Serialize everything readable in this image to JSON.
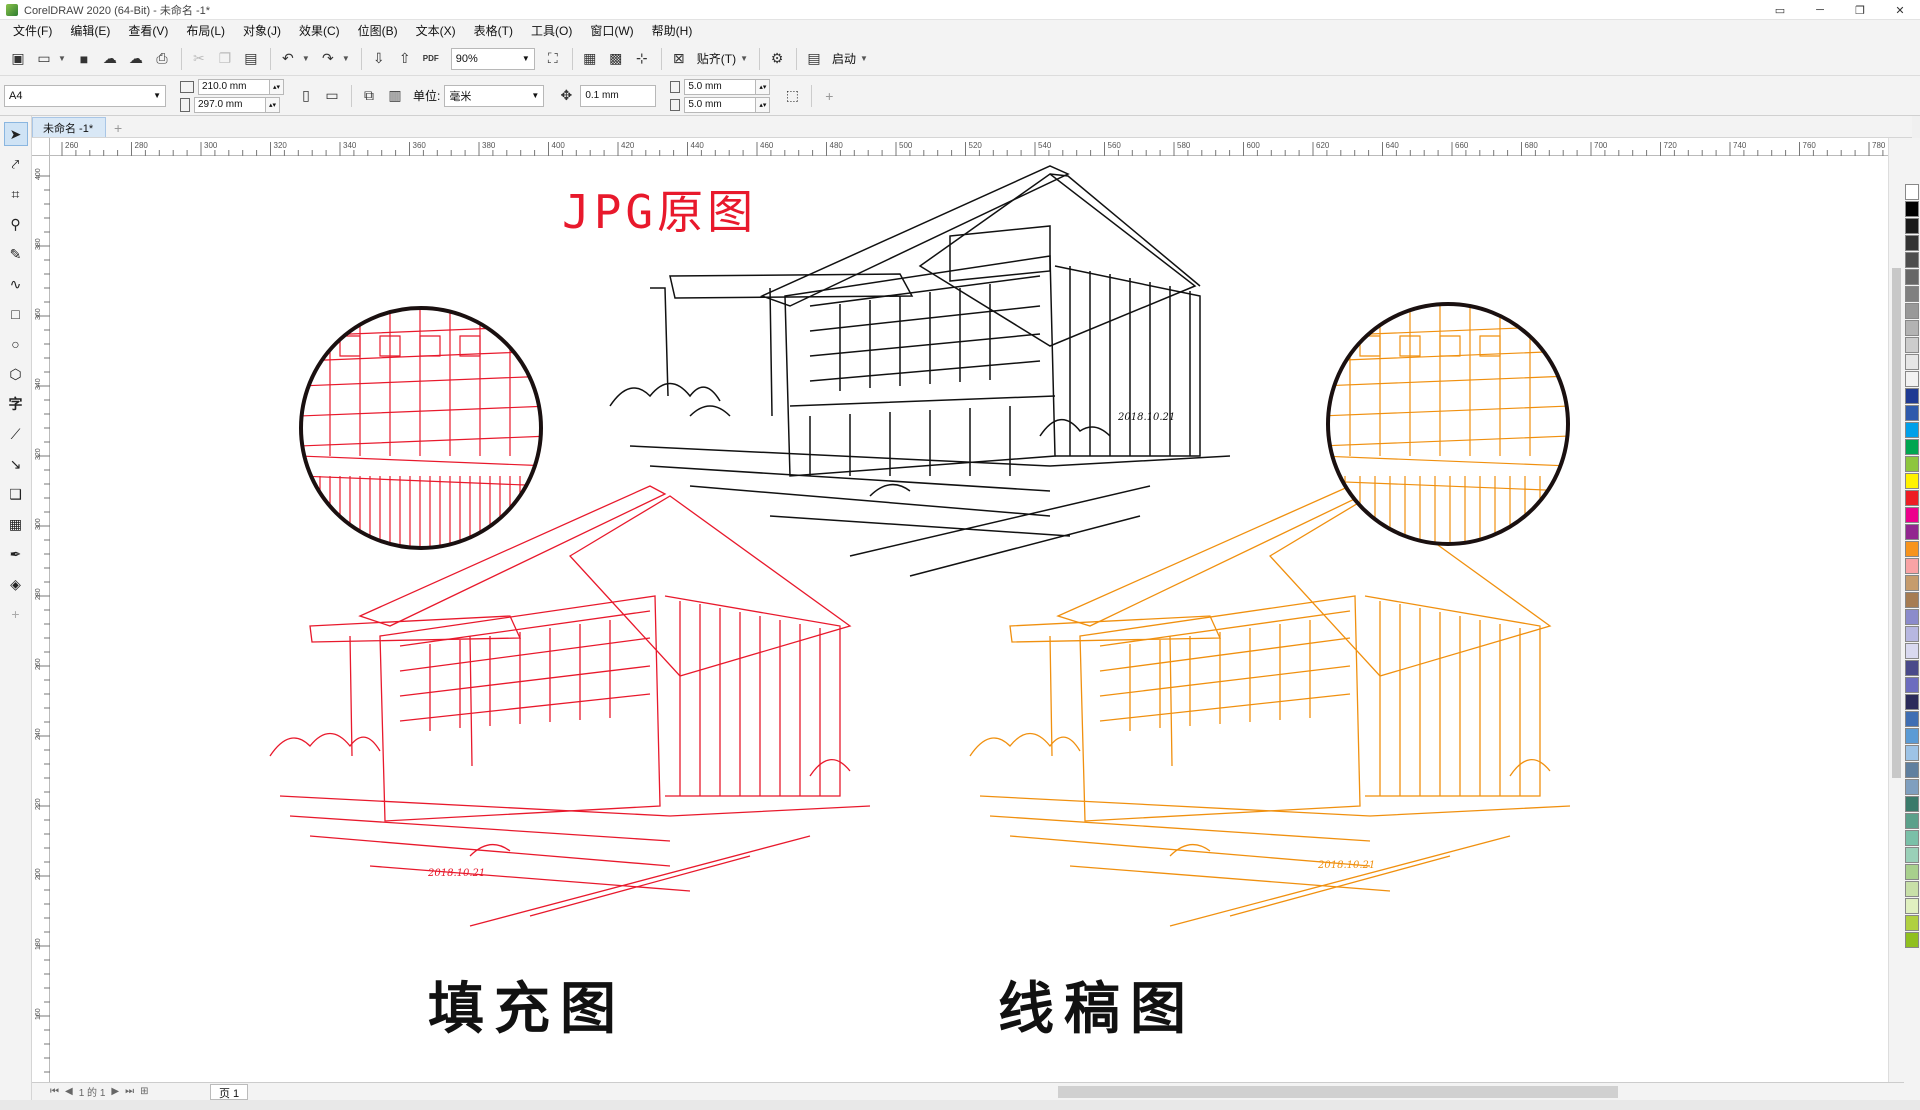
{
  "window": {
    "title": "CorelDRAW 2020 (64-Bit) - 未命名 -1*",
    "controls": [
      "▭",
      "─",
      "❐",
      "✕"
    ]
  },
  "menu": [
    "文件(F)",
    "编辑(E)",
    "查看(V)",
    "布局(L)",
    "对象(J)",
    "效果(C)",
    "位图(B)",
    "文本(X)",
    "表格(T)",
    "工具(O)",
    "窗口(W)",
    "帮助(H)"
  ],
  "toolbar": {
    "zoom": "90%",
    "pdf_label": "PDF",
    "snap_label": "贴齐(T)",
    "launch_label": "启动"
  },
  "propbar": {
    "page_size": "A4",
    "width": "210.0 mm",
    "height": "297.0 mm",
    "units_label": "单位:",
    "units_value": "毫米",
    "nudge": "0.1 mm",
    "dup_x": "5.0 mm",
    "dup_y": "5.0 mm"
  },
  "doc_tab": "未命名 -1*",
  "ruler": {
    "h_labels": [
      "260",
      "280",
      "300",
      "320",
      "340",
      "360",
      "380",
      "400",
      "420",
      "440",
      "460",
      "480",
      "500",
      "520",
      "540",
      "560",
      "580",
      "600",
      "620",
      "640",
      "660",
      "680",
      "700",
      "720",
      "740",
      "760",
      "780"
    ],
    "v_labels": [
      "400",
      "380",
      "360",
      "340",
      "320",
      "300",
      "280",
      "260",
      "240",
      "220",
      "200",
      "180",
      "160"
    ]
  },
  "canvas": {
    "title_jpg": "JPG原图",
    "label_fill": "填充图",
    "label_outline": "线稿图",
    "date_mark": "2018.10.21",
    "colors": {
      "red": "#e8192c",
      "orange": "#f0900f",
      "black": "#111111"
    }
  },
  "page_nav": {
    "page_of": "1 的 1",
    "page_tab": "页 1"
  },
  "palette": [
    "#ffffff",
    "#000000",
    "#1a1a1a",
    "#333333",
    "#4d4d4d",
    "#666666",
    "#808080",
    "#999999",
    "#b3b3b3",
    "#cccccc",
    "#e6e6e6",
    "#f2f2f2",
    "#1f3a93",
    "#2e5aac",
    "#00a0e9",
    "#00a651",
    "#8dc63f",
    "#fff200",
    "#ed1c24",
    "#ec008c",
    "#92278f",
    "#f7941d",
    "#f9a3a5",
    "#c69c6d",
    "#a67c52",
    "#8b8bcb",
    "#b7b7e0",
    "#d9d9f0",
    "#4a4a8a",
    "#6d6dbf",
    "#2b2b5a",
    "#3f6eb3",
    "#5b9bd5",
    "#9dc3e6",
    "#5f7f9f",
    "#7f9fbf",
    "#3a7a6a",
    "#5aa08a",
    "#7ac0a8",
    "#9ad0b8",
    "#a8d08d",
    "#c8e0a8",
    "#e0f0c0",
    "#b0d040",
    "#90c020"
  ]
}
